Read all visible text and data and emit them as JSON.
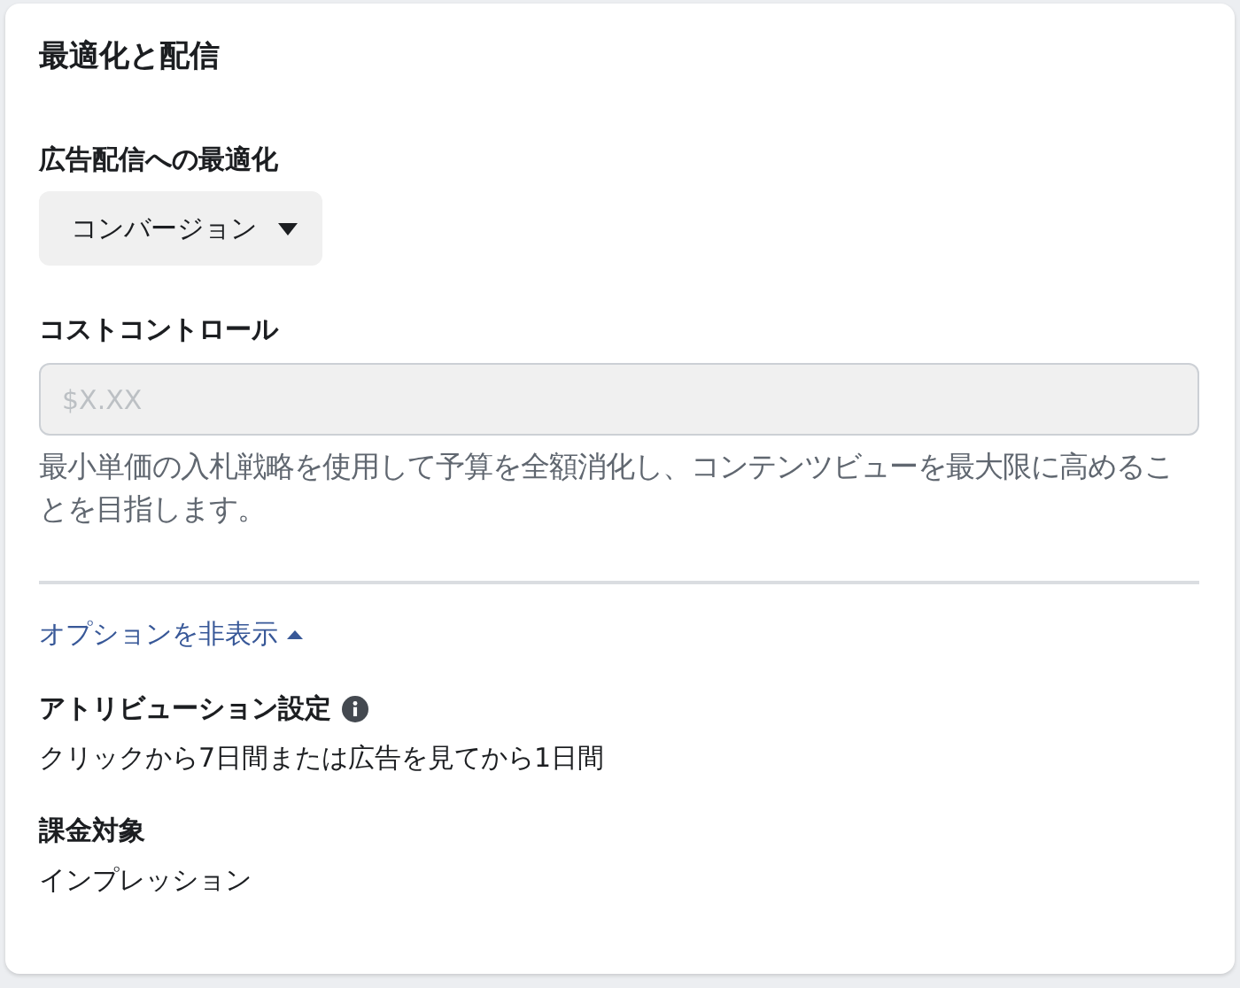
{
  "title": "最適化と配信",
  "optimization": {
    "label": "広告配信への最適化",
    "value": "コンバージョン"
  },
  "cost_control": {
    "label": "コストコントロール",
    "placeholder": "$X.XX",
    "disabled": true,
    "description": "最小単価の入札戦略を使用して予算を全額消化し、コンテンツビューを最大限に高めることを目指します。"
  },
  "options_toggle": {
    "label": "オプションを非表示",
    "expanded": true
  },
  "settings": [
    {
      "label": "アトリビューション設定",
      "info": true,
      "value": "クリックから7日間または広告を見てから1日間"
    },
    {
      "label": "課金対象",
      "info": false,
      "value": "インプレッション"
    }
  ]
}
